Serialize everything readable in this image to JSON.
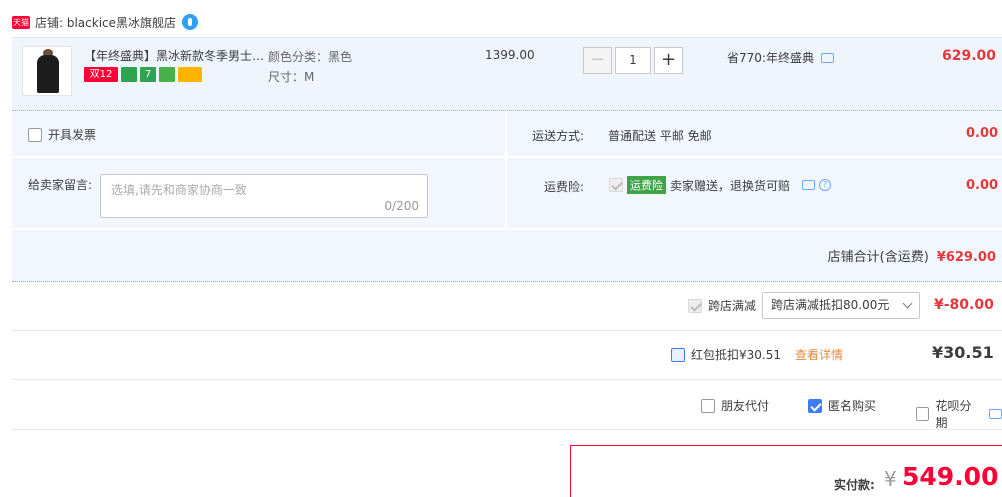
{
  "shop": {
    "badge": "天猫",
    "label": "店铺: blackice黑冰旗舰店"
  },
  "item": {
    "title": "【年终盛典】黑冰新款冬季男士…",
    "promos": [
      {
        "label": "双12",
        "color": "#ff0036"
      },
      {
        "label": "",
        "color": "#2fa351"
      },
      {
        "label": "7",
        "color": "#2fa351"
      },
      {
        "label": "",
        "color": "#48b24a"
      },
      {
        "label": "",
        "color": "#ffb400"
      }
    ],
    "sku_color": "颜色分类：黑色",
    "sku_size": "尺寸：M",
    "unit_price": "1399.00",
    "qty_minus": "−",
    "qty_value": "1",
    "qty_plus": "+",
    "discount": "省770:年终盛典",
    "total": "629.00"
  },
  "options": {
    "invoice": "开具发票",
    "message_label": "给卖家留言:",
    "message_placeholder": "选填,请先和商家协商一致",
    "message_count": "0/200",
    "shipping_label": "运送方式:",
    "shipping_value": "普通配送 平邮 免邮",
    "shipping_price": "0.00",
    "insurance_label": "运费险:",
    "insurance_tag": "运费险",
    "insurance_text": "卖家赠送，退换货可赔",
    "insurance_price": "0.00",
    "shop_total_label": "店铺合计(含运费)",
    "shop_total_value": "¥629.00"
  },
  "discounts": {
    "cross_label": "跨店满减",
    "cross_select": "跨店满减抵扣80.00元",
    "cross_price": "¥-80.00",
    "hongbao_label": "红包抵扣¥30.51",
    "hongbao_detail": "查看详情",
    "hongbao_price": "¥30.51"
  },
  "extras": {
    "friend_pay": "朋友代付",
    "anonymous": "匿名购买",
    "huabei": "花呗分期"
  },
  "pay": {
    "label": "实付款:",
    "yen": "¥",
    "amount": "549.00"
  }
}
